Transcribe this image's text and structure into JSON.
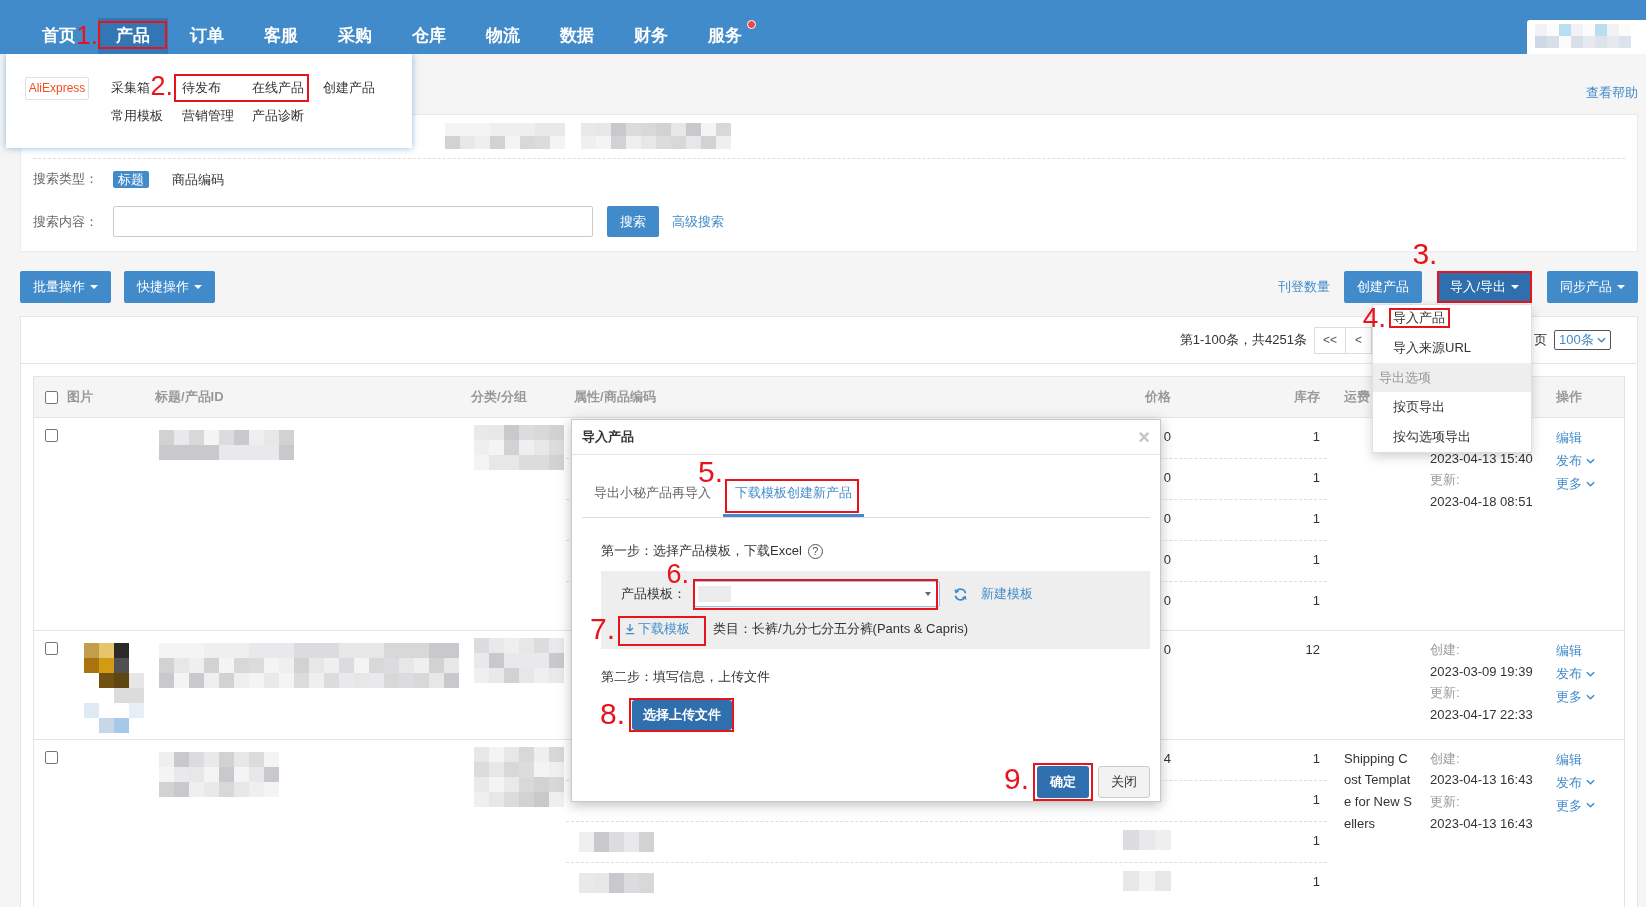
{
  "nav": {
    "items": [
      {
        "label": "首页",
        "selected": false,
        "notice": false
      },
      {
        "label": "产品",
        "selected": true,
        "notice": false,
        "step": "1."
      },
      {
        "label": "订单",
        "selected": false,
        "notice": false
      },
      {
        "label": "客服",
        "selected": false,
        "notice": false
      },
      {
        "label": "采购",
        "selected": false,
        "notice": false
      },
      {
        "label": "仓库",
        "selected": false,
        "notice": false
      },
      {
        "label": "物流",
        "selected": false,
        "notice": false
      },
      {
        "label": "数据",
        "selected": false,
        "notice": false
      },
      {
        "label": "财务",
        "selected": false,
        "notice": false
      },
      {
        "label": "服务",
        "selected": false,
        "notice": true
      }
    ],
    "account": {
      "blurred": true
    }
  },
  "product_menu": {
    "logo": "AliExpress",
    "rows": [
      [
        {
          "label": "采集箱",
          "framed": false
        },
        {
          "label": "待发布",
          "framed": true,
          "step": "2."
        },
        {
          "label": "在线产品",
          "framed": true
        },
        {
          "label": "创建产品",
          "framed": false
        }
      ],
      [
        {
          "label": "常用模板",
          "framed": false
        },
        {
          "label": "营销管理",
          "framed": false
        },
        {
          "label": "产品诊断",
          "framed": false
        }
      ]
    ]
  },
  "help_link": "查看帮助",
  "filter": {
    "store_row": {
      "blurred": true
    },
    "search_type": {
      "label": "搜索类型：",
      "options": [
        {
          "label": "标题",
          "selected": true
        },
        {
          "label": "商品编码",
          "selected": false
        }
      ]
    },
    "search_content": {
      "label": "搜索内容："
    },
    "search_button": "搜索",
    "advanced_link": "高级搜索"
  },
  "toolbar": {
    "left": [
      {
        "label": "批量操作",
        "dropdown": true,
        "expanded": false
      },
      {
        "label": "快捷操作",
        "dropdown": true,
        "expanded": false
      }
    ],
    "count_link": "刊登数量",
    "right": [
      {
        "label": "创建产品",
        "dropdown": false,
        "expanded": false
      },
      {
        "label": "导入/导出",
        "dropdown": true,
        "expanded": true,
        "step": "3."
      },
      {
        "label": "同步产品",
        "dropdown": true,
        "expanded": false
      }
    ]
  },
  "import_export_menu": {
    "items": [
      {
        "kind": "item",
        "label": "导入产品",
        "step": "4."
      },
      {
        "kind": "item",
        "label": "导入来源URL"
      },
      {
        "kind": "header",
        "label": "导出选项"
      },
      {
        "kind": "item",
        "label": "按页导出"
      },
      {
        "kind": "item",
        "label": "按勾选项导出"
      }
    ]
  },
  "pagination": {
    "summary": "第1-100条，共4251条",
    "buttons": [
      "<<",
      "<"
    ],
    "page_label": "页",
    "page_size": "100条"
  },
  "table": {
    "select_all": {
      "checked": false
    },
    "columns": {
      "image": "图片",
      "title": "标题/产品ID",
      "category": "分类/分组",
      "attributes": "属性/商品编码",
      "price": "价格",
      "stock": "库存",
      "shipping": "运费",
      "actions": "操作"
    },
    "rows": [
      {
        "checked": false,
        "title_blurred": true,
        "category_blurred": true,
        "variants": [
          {
            "price": "0",
            "stock": "1"
          },
          {
            "price": "0",
            "stock": "1"
          },
          {
            "price": "0",
            "stock": "1"
          },
          {
            "price": "0",
            "stock": "1"
          },
          {
            "price": "0",
            "stock": "1"
          }
        ],
        "created": "2023-04-13 15:40",
        "updated_label": "更新:",
        "updated": "2023-04-18 08:51",
        "actions": [
          {
            "label": "编辑",
            "dropdown": false
          },
          {
            "label": "发布",
            "dropdown": true
          },
          {
            "label": "更多",
            "dropdown": true
          }
        ]
      },
      {
        "checked": false,
        "thumbnail": true,
        "title_blurred": true,
        "category_blurred": true,
        "variants": [
          {
            "price": "0",
            "stock": "12"
          }
        ],
        "created_label": "创建:",
        "created": "2023-03-09 19:39",
        "updated_label": "更新:",
        "updated": "2023-04-17 22:33",
        "actions": [
          {
            "label": "编辑",
            "dropdown": false
          },
          {
            "label": "发布",
            "dropdown": true
          },
          {
            "label": "更多",
            "dropdown": true
          }
        ]
      },
      {
        "checked": false,
        "title_blurred": true,
        "category_blurred": true,
        "variants": [
          {
            "price": "4",
            "stock": "1"
          },
          {
            "stock": "1"
          },
          {
            "stock": "1",
            "blurred": true
          },
          {
            "stock": "1",
            "blurred": true
          }
        ],
        "shipping": "Shipping Cost Template for New Sellers",
        "created_label": "创建:",
        "created": "2023-04-13 16:43",
        "updated_label": "更新:",
        "updated": "2023-04-13 16:43",
        "actions": [
          {
            "label": "编辑",
            "dropdown": false
          },
          {
            "label": "发布",
            "dropdown": true
          },
          {
            "label": "更多",
            "dropdown": true
          }
        ]
      }
    ]
  },
  "import_dialog": {
    "title": "导入产品",
    "close": "×",
    "tabs": [
      {
        "label": "导出小秘产品再导入",
        "selected": false
      },
      {
        "label": "下载模板创建新产品",
        "selected": true,
        "step": "5."
      }
    ],
    "step1": {
      "text": "第一步：选择产品模板，下载Excel",
      "help": "?"
    },
    "template": {
      "label": "产品模板：",
      "value_blurred": true,
      "step": "6."
    },
    "new_template_link": "新建模板",
    "download_link": {
      "label": "下载模板",
      "step": "7."
    },
    "category": "类目：长裤/九分七分五分裤(Pants & Capris)",
    "step2": "第二步：填写信息，上传文件",
    "upload_button": {
      "label": "选择上传文件",
      "step": "8."
    },
    "buttons": [
      {
        "label": "确定",
        "kind": "primary",
        "step": "9."
      },
      {
        "label": "关闭",
        "kind": "default"
      }
    ]
  }
}
